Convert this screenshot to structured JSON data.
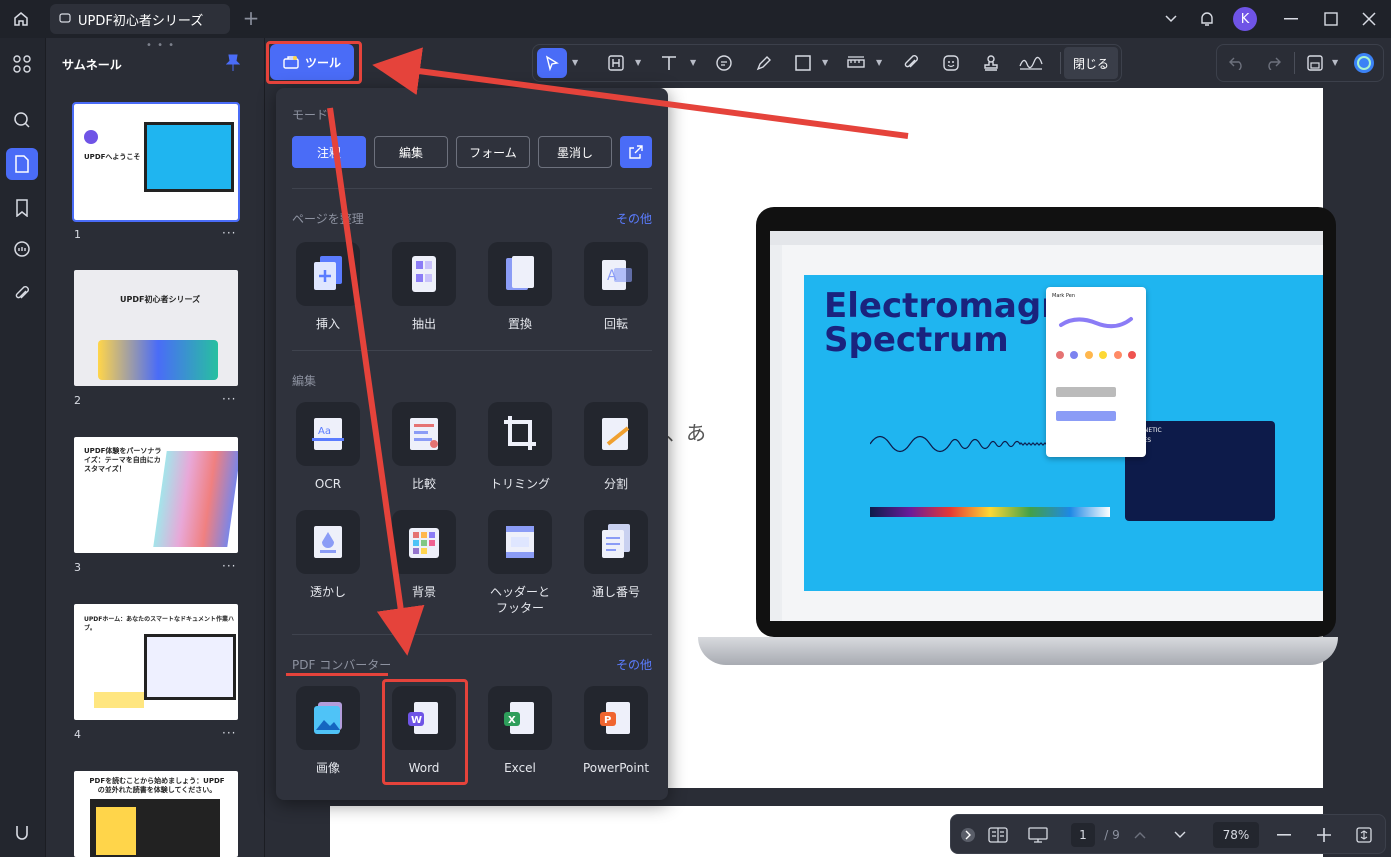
{
  "titlebar": {
    "tab_title": "UPDF初心者シリーズ",
    "tab_add": "+",
    "avatar_letter": "K"
  },
  "thumbnails": {
    "title": "サムネール",
    "pages": [
      {
        "num": "1",
        "heading": "UPDFへようこそ"
      },
      {
        "num": "2",
        "heading": "UPDF初心者シリーズ"
      },
      {
        "num": "3",
        "heading": "UPDF体験をパーソナライズ：テーマを自由にカスタマイズ！"
      },
      {
        "num": "4",
        "heading": "UPDFホーム：あなたのスマートなドキュメント作業ハブ。"
      },
      {
        "num": "",
        "heading": "PDFを読むことから始めましょう：UPDFの並外れた読書を体験してください。"
      }
    ],
    "more": "···"
  },
  "toolbar": {
    "tools_label": "ツール",
    "close_label": "閉じる"
  },
  "panel": {
    "mode_label": "モード",
    "modes": [
      "注釈",
      "編集",
      "フォーム",
      "墨消し"
    ],
    "organize": {
      "label": "ページを整理",
      "more": "その他",
      "items": [
        "挿入",
        "抽出",
        "置換",
        "回転"
      ]
    },
    "edit": {
      "label": "編集",
      "items": [
        "OCR",
        "比較",
        "トリミング",
        "分割",
        "透かし",
        "背景",
        "ヘッダーと\nフッター",
        "通し番号"
      ]
    },
    "convert": {
      "label": "PDF コンバーター",
      "more": "その他",
      "items": [
        "画像",
        "Word",
        "Excel",
        "PowerPoint"
      ]
    }
  },
  "document": {
    "char": "、あ",
    "laptop": {
      "spectrum_title": "Electromagnetic Spectrum",
      "mark_pen": "Mark Pen",
      "waves": "WAVES",
      "magnetic": "MAGNETIC"
    }
  },
  "statusbar": {
    "page_current": "1",
    "page_total": "/ 9",
    "zoom": "78%"
  },
  "colors": {
    "accent": "#4a6cf7",
    "annotation": "#e5433b",
    "panel": "#2f323c"
  }
}
